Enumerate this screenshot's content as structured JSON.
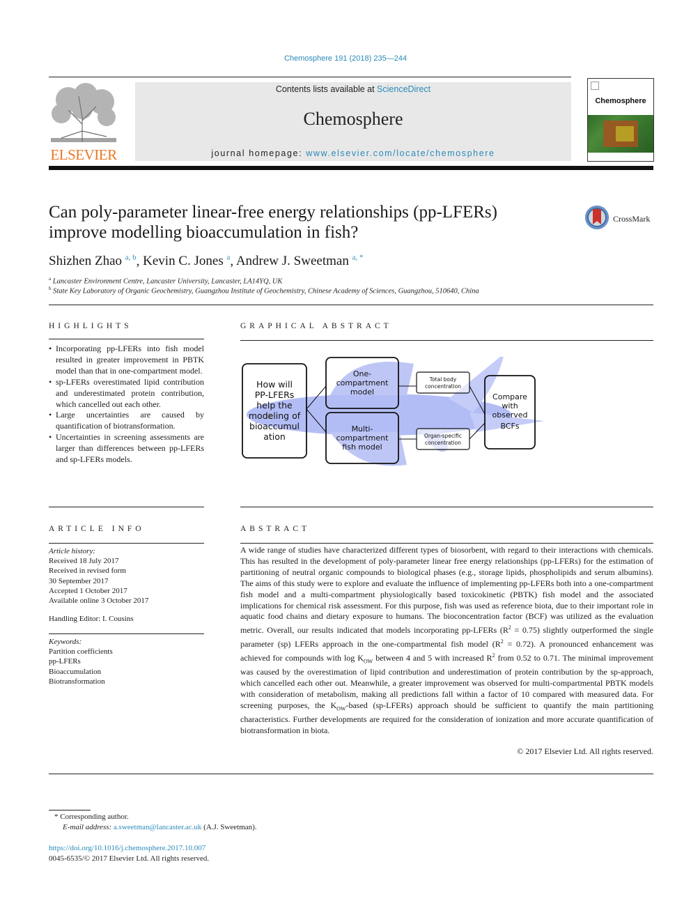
{
  "citation": "Chemosphere 191 (2018) 235—244",
  "publisher": {
    "logo_word": "ELSEVIER"
  },
  "masthead": {
    "contents_prefix": "Contents lists available at ",
    "contents_link": "ScienceDirect",
    "journal_name": "Chemosphere",
    "homepage_prefix": "journal homepage: ",
    "homepage_link": "www.elsevier.com/locate/chemosphere"
  },
  "cover": {
    "title": "Chemosphere"
  },
  "crossmark": {
    "label": "CrossMark"
  },
  "article": {
    "title_line1": "Can poly-parameter linear-free energy relationships (pp-LFERs)",
    "title_line2": "improve modelling bioaccumulation in fish?",
    "authors": [
      {
        "name": "Shizhen Zhao",
        "affil": "a, b",
        "sep": ", "
      },
      {
        "name": "Kevin C. Jones",
        "affil": "a",
        "sep": ", "
      },
      {
        "name": "Andrew J. Sweetman",
        "affil": "a, *",
        "sep": ""
      }
    ],
    "affiliations": [
      {
        "key": "a",
        "text": "Lancaster Environment Centre, Lancaster University, Lancaster, LA14YQ, UK"
      },
      {
        "key": "b",
        "text": "State Key Laboratory of Organic Geochemistry, Guangzhou Institute of Geochemistry, Chinese Academy of Sciences, Guangzhou, 510640, China"
      }
    ]
  },
  "highlights": {
    "heading": "HIGHLIGHTS",
    "items": [
      "Incorporating pp-LFERs into fish model resulted in greater improvement in PBTK model than that in one-compartment model.",
      "sp-LFERs overestimated lipid contribution and underestimated protein contribution, which cancelled out each other.",
      "Large uncertainties are caused by quantification of biotransformation.",
      "Uncertainties in screening assessments are larger than differences between pp-LFERs and sp-LFERs models."
    ]
  },
  "graphical_abstract": {
    "heading": "GRAPHICAL ABSTRACT",
    "question_lines": [
      "How will",
      "PP-LFERs",
      "help the",
      "modeling of",
      "bioaccumul",
      "ation"
    ],
    "one_compartment_lines": [
      "One-",
      "compartment",
      "model"
    ],
    "multi_compartment_lines": [
      "Multi-",
      "compartment",
      "fish model"
    ],
    "total_body_lines": [
      "Total body",
      "concentration"
    ],
    "organ_specific_lines": [
      "Organ-specific",
      "concentration"
    ],
    "compare_lines": [
      "Compare",
      "with",
      "observed",
      "BCFs"
    ],
    "fish_color": "#8a9cf0"
  },
  "article_info": {
    "heading": "ARTICLE INFO",
    "history_label": "Article history:",
    "history": [
      "Received 18 July 2017",
      "Received in revised form",
      "30 September 2017",
      "Accepted 1 October 2017",
      "Available online 3 October 2017"
    ],
    "handling_editor": "Handling Editor: I. Cousins",
    "keywords_label": "Keywords:",
    "keywords": [
      "Partition coefficients",
      "pp-LFERs",
      "Bioaccumulation",
      "Biotransformation"
    ]
  },
  "abstract": {
    "heading": "ABSTRACT",
    "part1": "A wide range of studies have characterized different types of biosorbent, with regard to their interactions with chemicals. This has resulted in the development of poly-parameter linear free energy relationships (pp-LFERs) for the estimation of partitioning of neutral organic compounds to biological phases (e.g., storage lipids, phospholipids and serum albumins). The aims of this study were to explore and evaluate the influence of implementing pp-LFERs both into a one-compartment fish model and a multi-compartment physiologically based toxicokinetic (PBTK) fish model and the associated implications for chemical risk assessment. For this purpose, fish was used as reference biota, due to their important role in aquatic food chains and dietary exposure to humans. The bioconcentration factor (BCF) was utilized as the evaluation metric. Overall, our results indicated that models incorporating pp-LFERs (R",
    "sup1": "2",
    "part2": " = 0.75) slightly outperformed the single parameter (sp) LFERs approach in the one-compartmental fish model (R",
    "sup2": "2",
    "part3": " = 0.72). A pronounced enhancement was achieved for compounds with log K",
    "sub1": "OW",
    "part4": " between 4 and 5 with increased R",
    "sup3": "2",
    "part5": " from 0.52 to 0.71. The minimal improvement was caused by the overestimation of lipid contribution and underestimation of protein contribution by the sp-approach, which cancelled each other out. Meanwhile, a greater improvement was observed for multi-compartmental PBTK models with consideration of metabolism, making all predictions fall within a factor of 10 compared with measured data. For screening purposes, the K",
    "sub2": "OW",
    "part6": "-based (sp-LFERs) approach should be sufficient to quantify the main partitioning characteristics. Further developments are required for the consideration of ionization and more accurate quantification of biotransformation in biota.",
    "copyright": "© 2017 Elsevier Ltd. All rights reserved."
  },
  "footnotes": {
    "corresponding": "* Corresponding author.",
    "email_label": "E-mail address: ",
    "email": "a.sweetman@lancaster.ac.uk",
    "email_suffix": " (A.J. Sweetman).",
    "doi": "https://doi.org/10.1016/j.chemosphere.2017.10.007",
    "issn": "0045-6535/© 2017 Elsevier Ltd. All rights reserved."
  }
}
